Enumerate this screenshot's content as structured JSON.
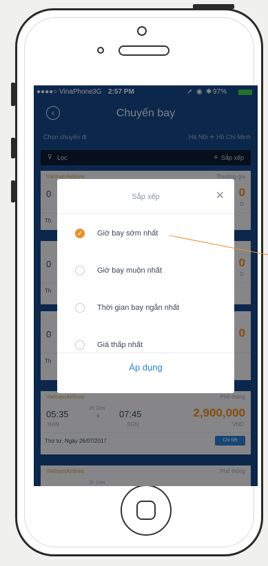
{
  "status_bar": {
    "carrier": "●●●●○ VinaPhone",
    "network": "3G",
    "time": "2:57 PM",
    "battery": "97%"
  },
  "nav": {
    "title": "Chuyến bay"
  },
  "route": {
    "left": "Chọn chuyến đi",
    "right": "Hà Nội ✈ Hồ Chí Minh"
  },
  "filter_bar": {
    "filter_label": "Lọc",
    "sort_label": "Sắp xếp"
  },
  "flights": [
    {
      "airline": "VietnamAirlines",
      "class": "Thương gia",
      "dep_time": "0",
      "dep_code": "",
      "duration": "",
      "arr_time": "",
      "arr_code": "",
      "price": "0",
      "currency": "D",
      "date": "Th",
      "detail": ""
    },
    {
      "airline": "",
      "class": "",
      "dep_time": "0",
      "dep_code": "",
      "duration": "",
      "arr_time": "",
      "arr_code": "",
      "price": "0",
      "currency": "D",
      "date": "Th",
      "detail": ""
    },
    {
      "airline": "",
      "class": "",
      "dep_time": "0",
      "dep_code": "",
      "duration": "",
      "arr_time": "",
      "arr_code": "",
      "price": "0",
      "currency": "",
      "date": "Th",
      "detail": ""
    },
    {
      "airline": "VietnamAirlines",
      "class": "Phổ thông",
      "dep_time": "05:35",
      "dep_code": "HAN",
      "duration": "2h 10m",
      "arr_time": "07:45",
      "arr_code": "SGN",
      "price": "2,900,000",
      "currency": "VND",
      "date": "Thứ tư, Ngày 26/07/2017",
      "detail": "Chi tiết"
    },
    {
      "airline": "VietnamAirlines",
      "class": "Phổ thông",
      "dep_time": "",
      "dep_code": "",
      "duration": "2h 10m",
      "arr_time": "",
      "arr_code": "",
      "price": "",
      "currency": "",
      "date": "",
      "detail": ""
    }
  ],
  "sort_dialog": {
    "title": "Sắp xếp",
    "close_icon": "close-icon",
    "options": [
      {
        "label": "Giờ bay sớm nhất",
        "selected": true
      },
      {
        "label": "Giờ bay muộn nhất",
        "selected": false
      },
      {
        "label": "Thời gian bay ngắn nhất",
        "selected": false
      },
      {
        "label": "Giá thấp nhất",
        "selected": false
      }
    ],
    "apply_label": "Áp dụng"
  },
  "colors": {
    "header_blue": "#16478a",
    "accent_orange": "#f18c2a",
    "link_blue": "#2a7fd4"
  }
}
